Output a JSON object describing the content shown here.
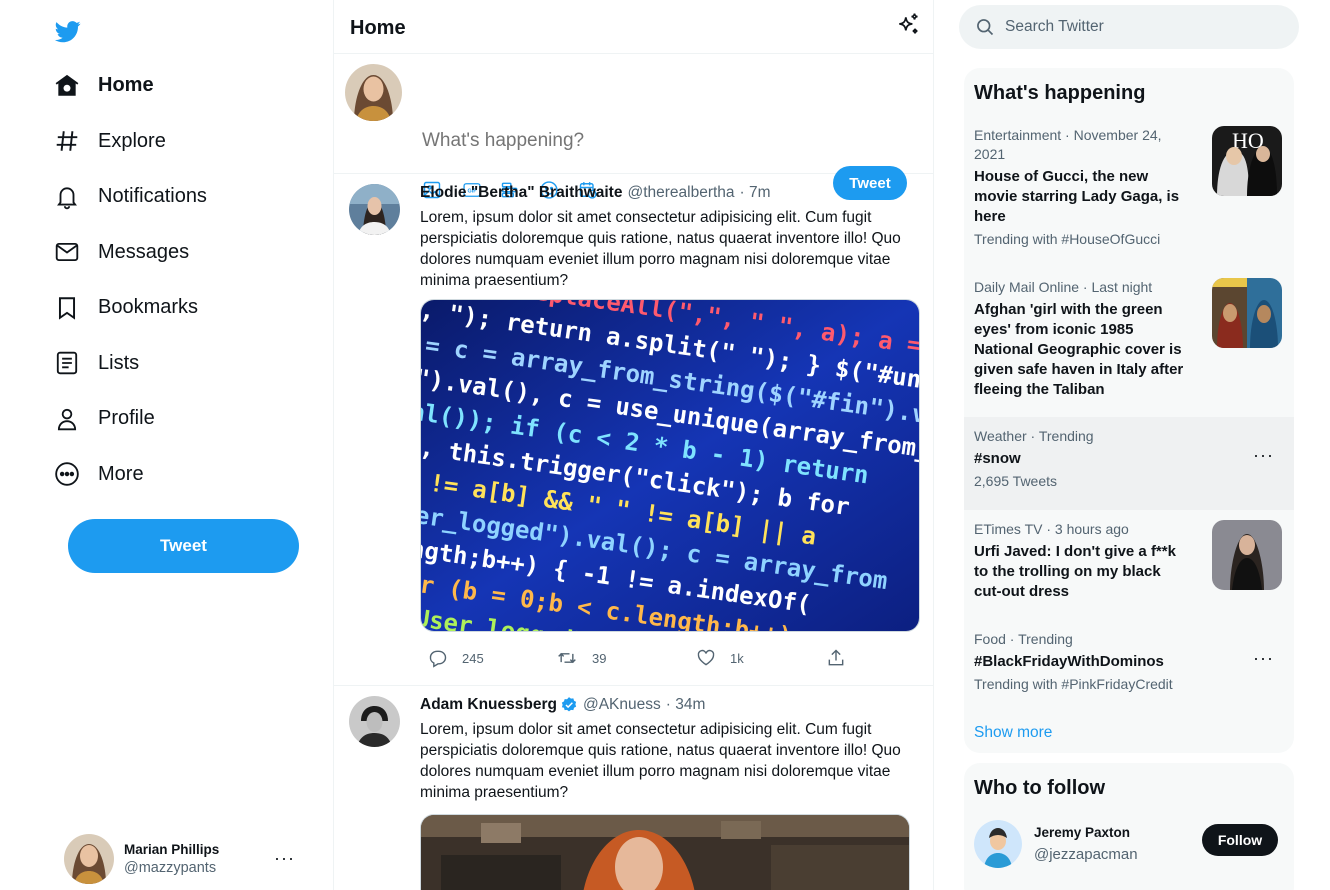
{
  "brand": {
    "accent": "#1d9bf0",
    "logo_icon": "twitter-bird-icon"
  },
  "nav": [
    {
      "label": "Home",
      "icon": "home-icon",
      "active": true
    },
    {
      "label": "Explore",
      "icon": "hashtag-icon"
    },
    {
      "label": "Notifications",
      "icon": "bell-icon"
    },
    {
      "label": "Messages",
      "icon": "envelope-icon"
    },
    {
      "label": "Bookmarks",
      "icon": "bookmark-icon"
    },
    {
      "label": "Lists",
      "icon": "list-icon"
    },
    {
      "label": "Profile",
      "icon": "person-icon"
    },
    {
      "label": "More",
      "icon": "more-circle-icon"
    }
  ],
  "sidebar": {
    "tweet_label": "Tweet"
  },
  "account": {
    "name": "Marian Phillips",
    "handle": "@mazzypants",
    "menu": "···"
  },
  "main": {
    "title": "Home",
    "compose": {
      "placeholder": "What's happening?",
      "tweet_label": "Tweet"
    }
  },
  "tweets": [
    {
      "name": "Elodie \"Bertha\" Braithwaite",
      "handle": "@therealbertha",
      "time": "· 7m",
      "verified": false,
      "text": "Lorem, ipsum dolor sit amet consectetur adipisicing elit. Cum fugit perspiciatis doloremque quis ratione, natus quaerat inventore illo! Quo dolores numquam eveniet illum porro magnam nisi doloremque vitae minima praesentium?",
      "replies": "245",
      "retweets": "39",
      "likes": "1k"
    },
    {
      "name": "Adam Knuessberg",
      "handle": "@AKnuess",
      "time": "· 34m",
      "verified": true,
      "text": "Lorem, ipsum dolor sit amet consectetur adipisicing elit. Cum fugit perspiciatis doloremque quis ratione, natus quaerat inventore illo! Quo dolores numquam eveniet illum porro magnam nisi doloremque vitae minima praesentium?"
    }
  ],
  "search": {
    "placeholder": "Search Twitter"
  },
  "trends": {
    "title": "What's happening",
    "items": [
      {
        "meta": "Entertainment · November 24, 2021",
        "title": "House of Gucci, the new movie starring Lady Gaga, is here",
        "sub": "Trending with #HouseOfGucci"
      },
      {
        "meta": "Daily Mail Online · Last night",
        "title": "Afghan 'girl with the green eyes' from iconic 1985 National Geographic cover is given safe haven in Italy after fleeing the Taliban",
        "sub": ""
      },
      {
        "meta": "Weather · Trending",
        "title": "#snow",
        "sub": "2,695 Tweets"
      },
      {
        "meta": "ETimes TV · 3 hours ago",
        "title": "Urfi Javed: I don't give a f**k to the trolling on my black cut-out dress",
        "sub": ""
      },
      {
        "meta": "Food · Trending",
        "title": "#BlackFridayWithDominos",
        "sub": "Trending with #PinkFridayCredit"
      }
    ],
    "show_more": "Show more"
  },
  "who_to_follow": {
    "title": "Who to follow",
    "users": [
      {
        "name": "Jeremy Paxton",
        "handle": "@jezzapacman",
        "button": "Follow"
      }
    ]
  }
}
